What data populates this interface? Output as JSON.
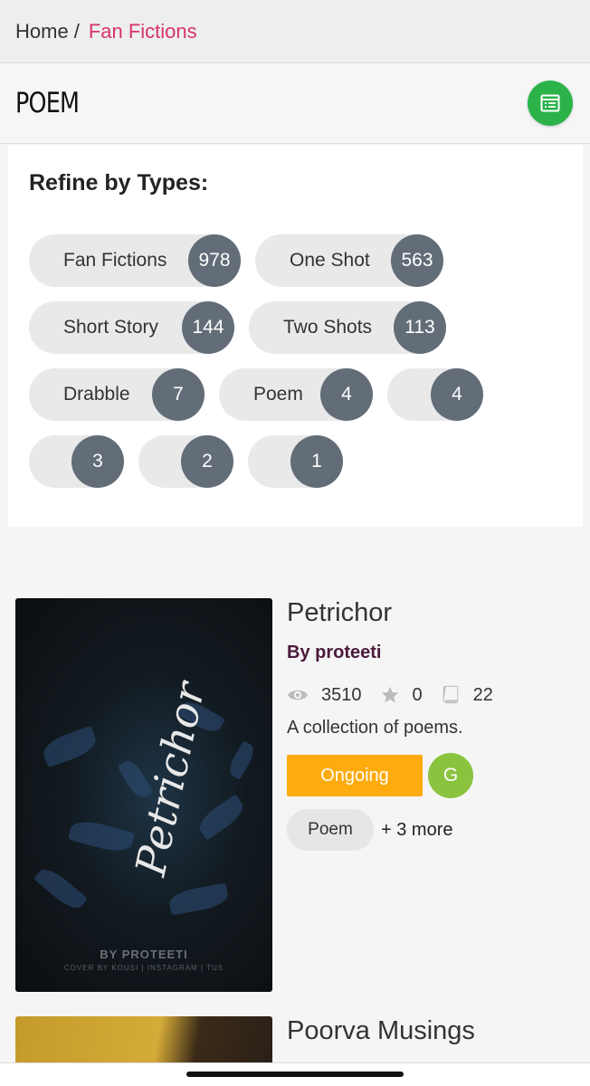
{
  "breadcrumb": {
    "home": "Home",
    "separator": "/",
    "current": "Fan Fictions"
  },
  "header": {
    "title": "POEM",
    "list_icon": "list-icon"
  },
  "refine": {
    "title": "Refine by Types:",
    "chips": [
      {
        "label": "Fan Fictions",
        "count": "978"
      },
      {
        "label": "One Shot",
        "count": "563"
      },
      {
        "label": "Short Story",
        "count": "144"
      },
      {
        "label": "Two Shots",
        "count": "113"
      },
      {
        "label": "Drabble",
        "count": "7"
      },
      {
        "label": "Poem",
        "count": "4"
      },
      {
        "label": "",
        "count": "4"
      },
      {
        "label": "",
        "count": "3"
      },
      {
        "label": "",
        "count": "2"
      },
      {
        "label": "",
        "count": "1"
      }
    ]
  },
  "stories": [
    {
      "title": "Petrichor",
      "author": "By proteeti",
      "cover_text": "Petrichor",
      "cover_by": "BY PROTEETI",
      "cover_credit": "COVER BY KOUSI | INSTAGRAM | TUS",
      "views": "3510",
      "stars": "0",
      "chapters": "22",
      "description": "A collection of poems.",
      "status": "Ongoing",
      "rating": "G",
      "tag": "Poem",
      "more_tags": "+ 3 more"
    },
    {
      "title": "Poorva Musings"
    }
  ],
  "colors": {
    "accent": "#d6336c",
    "status": "#fdab0d",
    "rating": "#8ac33e",
    "list_button": "#2bb34a",
    "count_badge": "#626d78"
  }
}
